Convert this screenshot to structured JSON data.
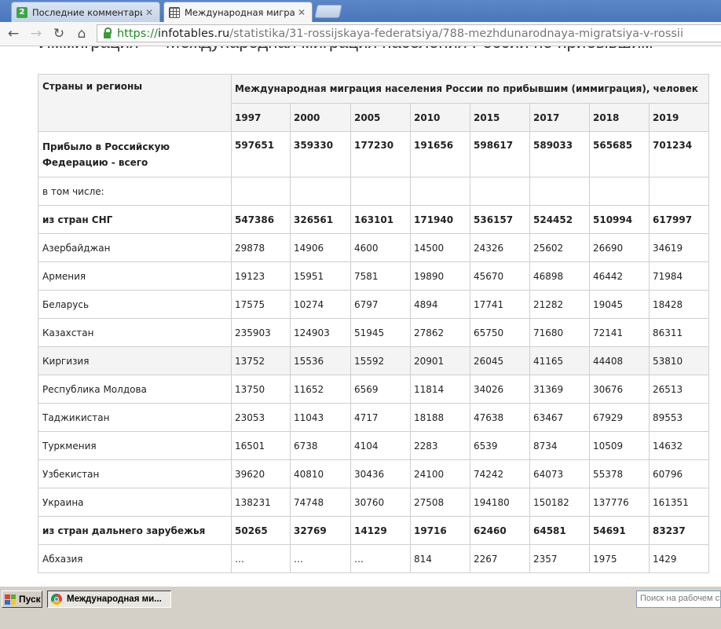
{
  "browser": {
    "tabs": [
      {
        "title": "Последние комментарии /",
        "active": false,
        "favicon": "green-2-icon"
      },
      {
        "title": "Международная миграция",
        "active": true,
        "favicon": "table-icon"
      }
    ],
    "address": {
      "scheme": "https://",
      "host": "infotables.ru",
      "path": "/statistika/31-rossijskaya-federatsiya/788-mezhdunarodnaya-migratsiya-v-rossii"
    }
  },
  "page": {
    "heading": "Иммиграция — Международная миграция населения России по прибывшим",
    "table": {
      "row_header": "Страны и регионы",
      "group_header": "Международная миграция населения России по прибывшим (иммиграция), человек",
      "years": [
        "1997",
        "2000",
        "2005",
        "2010",
        "2015",
        "2017",
        "2018",
        "2019"
      ],
      "rows": [
        {
          "label": "Прибыло в Российскую Федерацию - всего",
          "bold": true,
          "values": [
            "597651",
            "359330",
            "177230",
            "191656",
            "598617",
            "589033",
            "565685",
            "701234"
          ]
        },
        {
          "label": "в том числе:",
          "bold": false,
          "values": [
            "",
            "",
            "",
            "",
            "",
            "",
            "",
            ""
          ]
        },
        {
          "label": "из стран СНГ",
          "bold": true,
          "values": [
            "547386",
            "326561",
            "163101",
            "171940",
            "536157",
            "524452",
            "510994",
            "617997"
          ]
        },
        {
          "label": "Азербайджан",
          "bold": false,
          "values": [
            "29878",
            "14906",
            "4600",
            "14500",
            "24326",
            "25602",
            "26690",
            "34619"
          ]
        },
        {
          "label": "Армения",
          "bold": false,
          "values": [
            "19123",
            "15951",
            "7581",
            "19890",
            "45670",
            "46898",
            "46442",
            "71984"
          ]
        },
        {
          "label": "Беларусь",
          "bold": false,
          "values": [
            "17575",
            "10274",
            "6797",
            "4894",
            "17741",
            "21282",
            "19045",
            "18428"
          ]
        },
        {
          "label": "Казахстан",
          "bold": false,
          "values": [
            "235903",
            "124903",
            "51945",
            "27862",
            "65750",
            "71680",
            "72141",
            "86311"
          ]
        },
        {
          "label": "Киргизия",
          "bold": false,
          "values": [
            "13752",
            "15536",
            "15592",
            "20901",
            "26045",
            "41165",
            "44408",
            "53810"
          ]
        },
        {
          "label": "Республика Молдова",
          "bold": false,
          "values": [
            "13750",
            "11652",
            "6569",
            "11814",
            "34026",
            "31369",
            "30676",
            "26513"
          ]
        },
        {
          "label": "Таджикистан",
          "bold": false,
          "values": [
            "23053",
            "11043",
            "4717",
            "18188",
            "47638",
            "63467",
            "67929",
            "89553"
          ]
        },
        {
          "label": "Туркмения",
          "bold": false,
          "values": [
            "16501",
            "6738",
            "4104",
            "2283",
            "6539",
            "8734",
            "10509",
            "14632"
          ]
        },
        {
          "label": "Узбекистан",
          "bold": false,
          "values": [
            "39620",
            "40810",
            "30436",
            "24100",
            "74242",
            "64073",
            "55378",
            "60796"
          ]
        },
        {
          "label": "Украина",
          "bold": false,
          "values": [
            "138231",
            "74748",
            "30760",
            "27508",
            "194180",
            "150182",
            "137776",
            "161351"
          ]
        },
        {
          "label": "из стран дальнего зарубежья",
          "bold": true,
          "values": [
            "50265",
            "32769",
            "14129",
            "19716",
            "62460",
            "64581",
            "54691",
            "83237"
          ]
        },
        {
          "label": "Абхазия",
          "bold": false,
          "values": [
            "…",
            "…",
            "…",
            "814",
            "2267",
            "2357",
            "1975",
            "1429"
          ]
        }
      ]
    }
  },
  "taskbar": {
    "start_label": "Пуск",
    "window_button": "Международная ми...",
    "search_placeholder": "Поиск на рабочем ст"
  }
}
